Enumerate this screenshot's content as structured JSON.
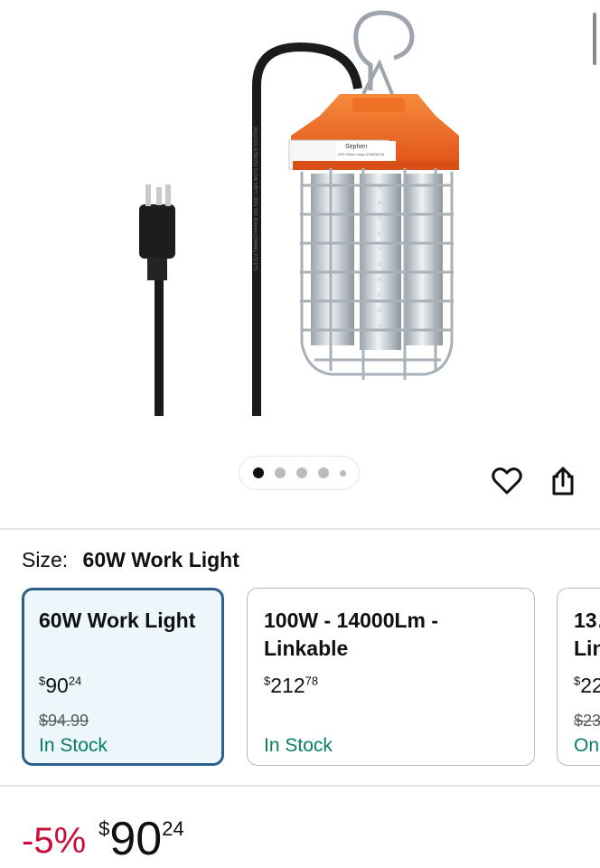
{
  "product": {
    "cord_label": "(UL)(CUL) E356753 SJOW 105°C 300V 3X0.824mm²(18AWG) FT2 FT1",
    "brand_label": "Sephen",
    "sticker_label": "LED Work Lamp (CW60A-N)"
  },
  "carousel": {
    "dot_count": 5,
    "active_index": 0
  },
  "size": {
    "label": "Size:",
    "selected": "60W Work Light"
  },
  "options": [
    {
      "name": "60W Work Light",
      "price_symbol": "$",
      "price_whole": "90",
      "price_fraction": "24",
      "list_price": "$94.99",
      "stock": "In Stock"
    },
    {
      "name": "100W - 14000Lm - Linkable",
      "price_symbol": "$",
      "price_whole": "212",
      "price_fraction": "78",
      "list_price": "",
      "stock": "In Stock"
    },
    {
      "name": "13… Lin…",
      "price_symbol": "$",
      "price_whole": "22",
      "price_fraction": "",
      "list_price": "$23",
      "stock": "On"
    }
  ],
  "deal": {
    "discount": "-5%",
    "price_symbol": "$",
    "price_whole": "90",
    "price_fraction": "24"
  },
  "colors": {
    "discount": "#cc0c39",
    "stock": "#067d62",
    "selected_border": "#2e5f8a",
    "selected_bg": "#edf7fb",
    "lamp_orange": "#f26a21"
  }
}
